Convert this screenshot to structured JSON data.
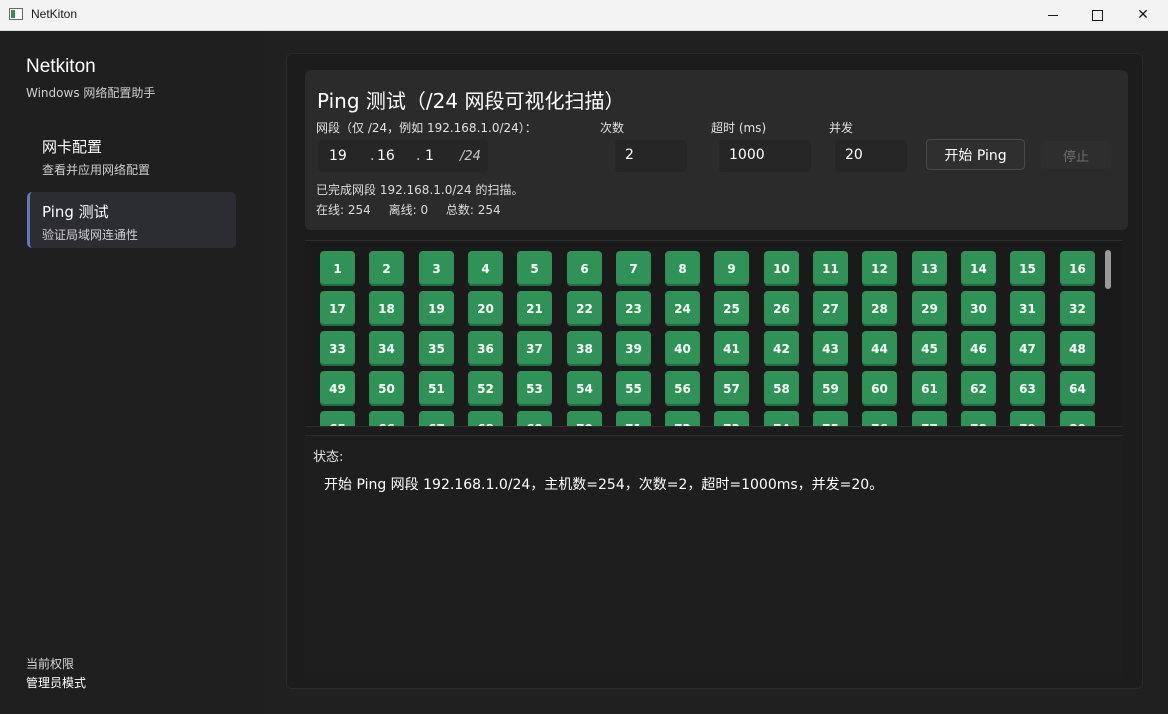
{
  "window": {
    "title": "NetKiton"
  },
  "sidebar": {
    "brand_title": "Netkiton",
    "brand_sub": "Windows 网络配置助手",
    "items": [
      {
        "label": "网卡配置",
        "sub": "查看并应用网络配置"
      },
      {
        "label": "Ping 测试",
        "sub": "验证局域网连通性"
      }
    ],
    "priv_label": "当前权限",
    "priv_value": "管理员模式"
  },
  "ping": {
    "title": "Ping 测试（/24 网段可视化扫描）",
    "net_label": "网段（仅 /24，例如 192.168.1.0/24）：",
    "count_label": "次数",
    "timeout_label": "超时 (ms)",
    "conc_label": "并发",
    "ip": {
      "o1": "19",
      "o2": "16",
      "o3": "1",
      "dot": ".",
      "mask": "/24"
    },
    "count_value": "2",
    "timeout_value": "1000",
    "conc_value": "20",
    "start_label": "开始 Ping",
    "stop_label": "停止",
    "done_text": "已完成网段 192.168.1.0/24 的扫描。",
    "online": "在线: 254",
    "offline": "离线: 0",
    "total": "总数: 254"
  },
  "hosts": {
    "visible_rows": 4,
    "cols": 16,
    "status": "online",
    "color_online": "#2f9358"
  },
  "status": {
    "title": "状态:",
    "message": "开始 Ping 网段 192.168.1.0/24，主机数=254，次数=2，超时=1000ms，并发=20。"
  }
}
